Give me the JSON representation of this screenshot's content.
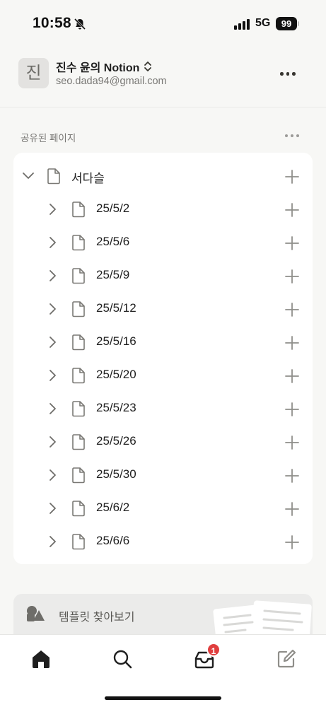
{
  "status_bar": {
    "time": "10:58",
    "network": "5G",
    "battery": "99"
  },
  "workspace": {
    "avatar_letter": "진",
    "name": "진수 윤의 Notion",
    "email": "seo.dada94@gmail.com"
  },
  "shared": {
    "section_label": "공유된 페이지",
    "root_page": "서다슬",
    "pages": [
      "25/5/2",
      "25/5/6",
      "25/5/9",
      "25/5/12",
      "25/5/16",
      "25/5/20",
      "25/5/23",
      "25/5/26",
      "25/5/30",
      "25/6/2",
      "25/6/6"
    ]
  },
  "templates": {
    "label": "템플릿 찾아보기"
  },
  "tab_bar": {
    "items": [
      "home-icon",
      "search-icon",
      "inbox-icon",
      "compose-icon"
    ],
    "inbox_badge": "1"
  },
  "colors": {
    "badge": "#e03e3e",
    "background": "#f7f7f5",
    "card": "#ffffff"
  }
}
